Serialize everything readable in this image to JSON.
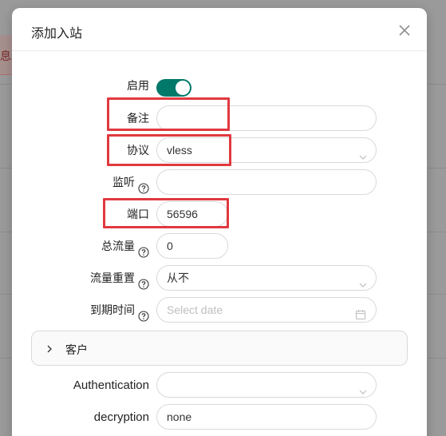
{
  "background": {
    "alert_fragment": "息。"
  },
  "modal": {
    "title": "添加入站",
    "close_icon": "close-icon"
  },
  "form": {
    "enable": {
      "label": "启用",
      "value": true
    },
    "remark": {
      "label": "备注",
      "value": ""
    },
    "protocol": {
      "label": "协议",
      "value": "vless"
    },
    "listen": {
      "label": "监听",
      "value": ""
    },
    "port": {
      "label": "端口",
      "value": "56596"
    },
    "total_traffic": {
      "label": "总流量",
      "value": "0"
    },
    "traffic_reset": {
      "label": "流量重置",
      "value": "从不"
    },
    "expiry_time": {
      "label": "到期时间",
      "placeholder": "Select date"
    },
    "clients_panel": {
      "label": "客户"
    },
    "authentication": {
      "label": "Authentication",
      "value": ""
    },
    "decryption": {
      "label": "decryption",
      "value": "none"
    }
  },
  "colors": {
    "toggle_on": "#00796b",
    "highlight": "#e0393f"
  }
}
